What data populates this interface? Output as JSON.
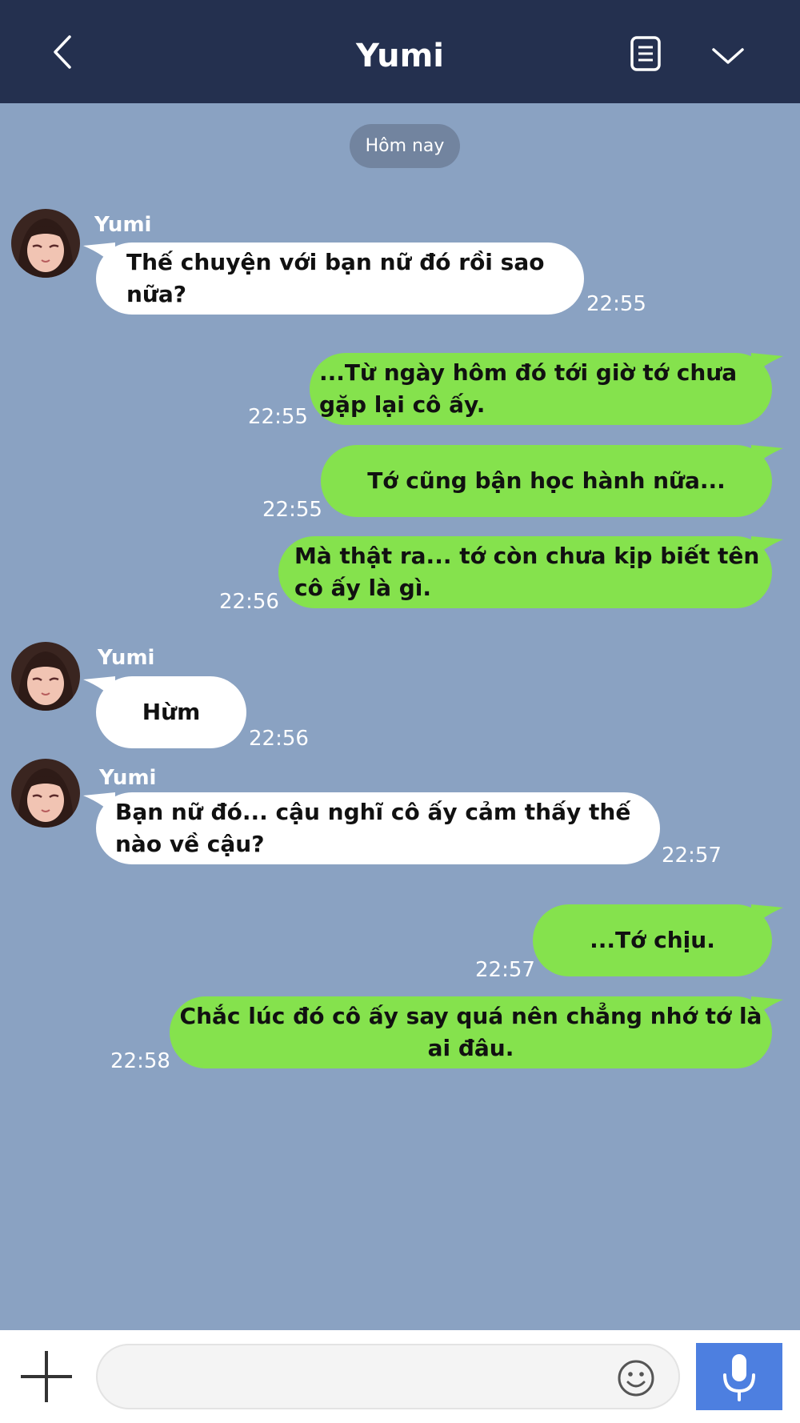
{
  "header": {
    "title": "Yumi",
    "background": "#24304f",
    "icons": {
      "back": "chevron-left-icon",
      "notes": "notes-icon",
      "collapse": "chevron-down-icon"
    }
  },
  "chat": {
    "background": "#8aa2c2",
    "date_label": "Hôm nay",
    "outgoing_color": "#85e24d",
    "incoming_color": "#ffffff",
    "messages": [
      {
        "from": "Yumi",
        "sender_label": "Yumi",
        "text": "Thế chuyện với bạn nữ đó rồi sao nữa?",
        "time": "22:55"
      },
      {
        "from": "me",
        "text": "...Từ ngày hôm đó tới giờ tớ chưa gặp lại cô ấy.",
        "time": "22:55"
      },
      {
        "from": "me",
        "text": "Tớ cũng bận học hành nữa...",
        "time": "22:55"
      },
      {
        "from": "me",
        "text": "Mà thật ra... tớ còn chưa kịp biết tên cô ấy là gì.",
        "time": "22:56"
      },
      {
        "from": "Yumi",
        "sender_label": "Yumi",
        "text": "Hừm",
        "time": "22:56"
      },
      {
        "from": "Yumi",
        "sender_label": "Yumi",
        "text": "Bạn nữ đó... cậu nghĩ cô ấy cảm thấy thế nào về cậu?",
        "time": "22:57"
      },
      {
        "from": "me",
        "text": "...Tớ chịu.",
        "time": "22:57"
      },
      {
        "from": "me",
        "text": "Chắc lúc đó cô ấy say quá nên chẳng nhớ tớ là ai đâu.",
        "time": "22:58"
      }
    ]
  },
  "composer": {
    "input_value": "",
    "icons": {
      "add": "plus-icon",
      "emoji": "smiley-icon",
      "voice": "microphone-icon"
    },
    "mic_color": "#4d7fe0"
  }
}
